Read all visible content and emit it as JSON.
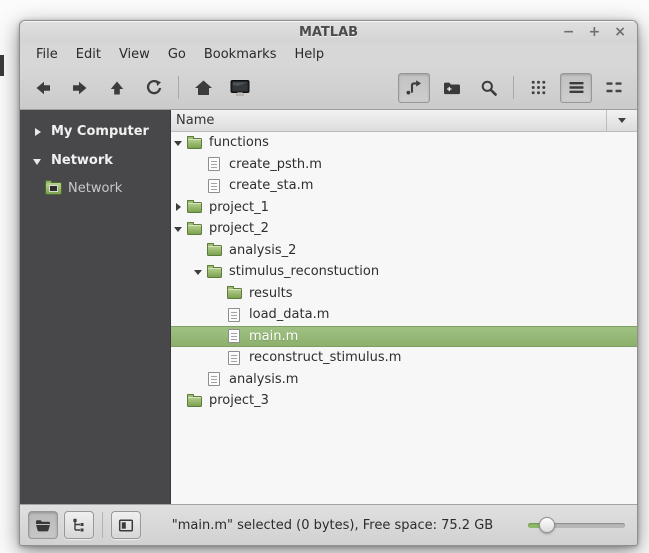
{
  "window": {
    "title": "MATLAB",
    "controls": {
      "minimize": "−",
      "maximize": "+",
      "close": "×"
    }
  },
  "menu": {
    "items": [
      "File",
      "Edit",
      "View",
      "Go",
      "Bookmarks",
      "Help"
    ]
  },
  "toolbar": {
    "left_icons": [
      "back",
      "forward",
      "up",
      "refresh",
      "home",
      "computer"
    ],
    "right_icons": [
      "toggle-location-entry",
      "new-folder",
      "search",
      "icon-view",
      "list-view",
      "compact-view"
    ],
    "pressed_buttons": [
      "toggle-location-entry",
      "list-view"
    ]
  },
  "sidebar": {
    "sections": [
      {
        "label": "My Computer",
        "state": "collapsed"
      },
      {
        "label": "Network",
        "state": "expanded"
      }
    ],
    "items": [
      {
        "label": "Network",
        "icon": "network-folder-icon"
      }
    ]
  },
  "list": {
    "header": {
      "label": "Name"
    },
    "rows": [
      {
        "label": "functions",
        "level": 0,
        "type": "folder",
        "expander": "expanded"
      },
      {
        "label": "create_psth.m",
        "level": 1,
        "type": "file"
      },
      {
        "label": "create_sta.m",
        "level": 1,
        "type": "file"
      },
      {
        "label": "project_1",
        "level": 0,
        "type": "folder",
        "expander": "collapsed"
      },
      {
        "label": "project_2",
        "level": 0,
        "type": "folder",
        "expander": "expanded"
      },
      {
        "label": "analysis_2",
        "level": 1,
        "type": "folder"
      },
      {
        "label": "stimulus_reconstuction",
        "level": 1,
        "type": "folder",
        "expander": "expanded"
      },
      {
        "label": "results",
        "level": 2,
        "type": "folder"
      },
      {
        "label": "load_data.m",
        "level": 2,
        "type": "file"
      },
      {
        "label": "main.m",
        "level": 2,
        "type": "file",
        "selected": true
      },
      {
        "label": "reconstruct_stimulus.m",
        "level": 2,
        "type": "file"
      },
      {
        "label": "analysis.m",
        "level": 1,
        "type": "file"
      },
      {
        "label": "project_3",
        "level": 0,
        "type": "folder"
      }
    ]
  },
  "statusbar": {
    "text": "\"main.m\" selected (0 bytes), Free space: 75.2 GB",
    "buttons": [
      "show-places",
      "show-treeview",
      "hide-sidebar"
    ],
    "zoom_slider": {
      "position_percent": 18
    }
  },
  "colors": {
    "selection_green": "#8db06c",
    "folder_green_light": "#b7d18f",
    "folder_green_dark": "#7ca24f",
    "sidebar_bg": "#48484a",
    "slider_green": "#8db868"
  }
}
